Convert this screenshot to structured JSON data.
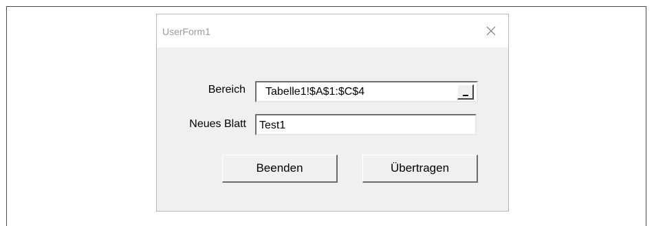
{
  "window": {
    "title": "UserForm1",
    "close_icon": "close-icon"
  },
  "form": {
    "bereich_label": "Bereich",
    "bereich_value": "Tabelle1!$A$1:$C$4",
    "ref_button_icon": "collapse-dialog-icon",
    "neues_blatt_label": "Neues Blatt",
    "neues_blatt_value": "Test1"
  },
  "buttons": {
    "beenden_label": "Beenden",
    "uebertragen_label": "Übertragen"
  }
}
